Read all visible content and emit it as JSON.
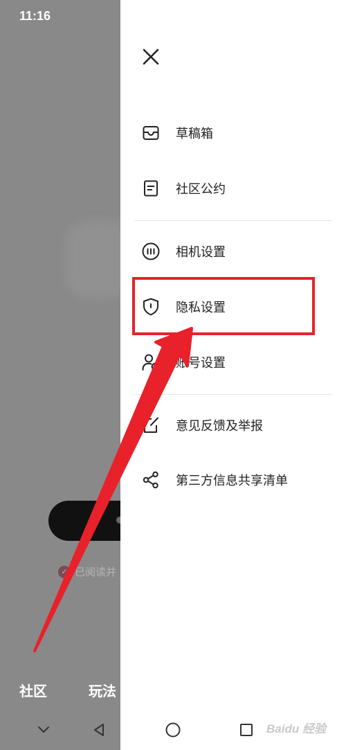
{
  "status_bar": {
    "time": "11:16"
  },
  "background_app": {
    "agree_text": "已阅读并",
    "tabs": [
      {
        "label": "社区"
      },
      {
        "label": "玩法"
      }
    ]
  },
  "drawer": {
    "groups": [
      [
        {
          "label": "草稿箱",
          "icon": "inbox-icon"
        },
        {
          "label": "社区公约",
          "icon": "document-icon"
        }
      ],
      [
        {
          "label": "相机设置",
          "icon": "camera-settings-icon"
        },
        {
          "label": "隐私设置",
          "icon": "shield-icon"
        },
        {
          "label": "账号设置",
          "icon": "user-gear-icon"
        }
      ],
      [
        {
          "label": "意见反馈及举报",
          "icon": "feedback-edit-icon"
        },
        {
          "label": "第三方信息共享清单",
          "icon": "share-icon"
        }
      ]
    ]
  },
  "annotation": {
    "highlight_color": "#e8212a"
  },
  "watermark": {
    "text": "Baidu 经验"
  }
}
